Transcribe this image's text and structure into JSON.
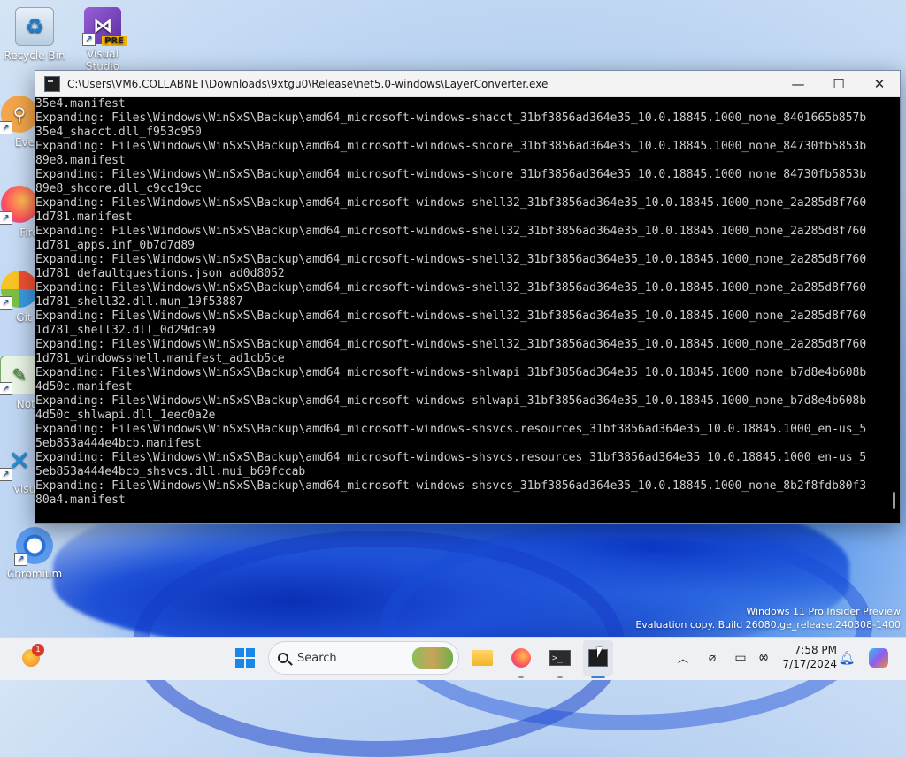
{
  "desktop": {
    "icons": [
      {
        "label": "Recycle Bin"
      },
      {
        "label": "Visual Studio",
        "badge": "PRE"
      },
      {
        "label": "Every"
      },
      {
        "label": "Fire"
      },
      {
        "label": "Git B"
      },
      {
        "label": "Note"
      },
      {
        "label": "Visual"
      },
      {
        "label": "Chromium"
      }
    ]
  },
  "window": {
    "title": "C:\\Users\\VM6.COLLABNET\\Downloads\\9xtgu0\\Release\\net5.0-windows\\LayerConverter.exe",
    "minimize": "—",
    "maximize": "☐",
    "close": "✕",
    "lines": [
      "35e4.manifest",
      "Expanding: Files\\Windows\\WinSxS\\Backup\\amd64_microsoft-windows-shacct_31bf3856ad364e35_10.0.18845.1000_none_8401665b857b",
      "35e4_shacct.dll_f953c950",
      "Expanding: Files\\Windows\\WinSxS\\Backup\\amd64_microsoft-windows-shcore_31bf3856ad364e35_10.0.18845.1000_none_84730fb5853b",
      "89e8.manifest",
      "Expanding: Files\\Windows\\WinSxS\\Backup\\amd64_microsoft-windows-shcore_31bf3856ad364e35_10.0.18845.1000_none_84730fb5853b",
      "89e8_shcore.dll_c9cc19cc",
      "Expanding: Files\\Windows\\WinSxS\\Backup\\amd64_microsoft-windows-shell32_31bf3856ad364e35_10.0.18845.1000_none_2a285d8f760",
      "1d781.manifest",
      "Expanding: Files\\Windows\\WinSxS\\Backup\\amd64_microsoft-windows-shell32_31bf3856ad364e35_10.0.18845.1000_none_2a285d8f760",
      "1d781_apps.inf_0b7d7d89",
      "Expanding: Files\\Windows\\WinSxS\\Backup\\amd64_microsoft-windows-shell32_31bf3856ad364e35_10.0.18845.1000_none_2a285d8f760",
      "1d781_defaultquestions.json_ad0d8052",
      "Expanding: Files\\Windows\\WinSxS\\Backup\\amd64_microsoft-windows-shell32_31bf3856ad364e35_10.0.18845.1000_none_2a285d8f760",
      "1d781_shell32.dll.mun_19f53887",
      "Expanding: Files\\Windows\\WinSxS\\Backup\\amd64_microsoft-windows-shell32_31bf3856ad364e35_10.0.18845.1000_none_2a285d8f760",
      "1d781_shell32.dll_0d29dca9",
      "Expanding: Files\\Windows\\WinSxS\\Backup\\amd64_microsoft-windows-shell32_31bf3856ad364e35_10.0.18845.1000_none_2a285d8f760",
      "1d781_windowsshell.manifest_ad1cb5ce",
      "Expanding: Files\\Windows\\WinSxS\\Backup\\amd64_microsoft-windows-shlwapi_31bf3856ad364e35_10.0.18845.1000_none_b7d8e4b608b",
      "4d50c.manifest",
      "Expanding: Files\\Windows\\WinSxS\\Backup\\amd64_microsoft-windows-shlwapi_31bf3856ad364e35_10.0.18845.1000_none_b7d8e4b608b",
      "4d50c_shlwapi.dll_1eec0a2e",
      "Expanding: Files\\Windows\\WinSxS\\Backup\\amd64_microsoft-windows-shsvcs.resources_31bf3856ad364e35_10.0.18845.1000_en-us_5",
      "5eb853a444e4bcb.manifest",
      "Expanding: Files\\Windows\\WinSxS\\Backup\\amd64_microsoft-windows-shsvcs.resources_31bf3856ad364e35_10.0.18845.1000_en-us_5",
      "5eb853a444e4bcb_shsvcs.dll.mui_b69fccab",
      "Expanding: Files\\Windows\\WinSxS\\Backup\\amd64_microsoft-windows-shsvcs_31bf3856ad364e35_10.0.18845.1000_none_8b2f8fdb80f3",
      "80a4.manifest"
    ]
  },
  "watermark": {
    "line1": "Windows 11 Pro Insider Preview",
    "line2": "Evaluation copy. Build 26080.ge_release.240308-1400"
  },
  "taskbar": {
    "search_label": "Search",
    "notification_count": "1",
    "time": "7:58 PM",
    "date": "7/17/2024",
    "icons": [
      "start-icon",
      "search-icon",
      "file-explorer-icon",
      "firefox-icon",
      "terminal-icon",
      "layer-converter-icon"
    ],
    "tray": [
      "chevron-up-icon",
      "network-icon",
      "display-icon",
      "accessibility-icon",
      "bell-icon",
      "copilot-icon"
    ]
  },
  "colors": {
    "console_bg": "#000000",
    "console_fg": "#cfcfcf",
    "accent": "#3d7be0"
  }
}
